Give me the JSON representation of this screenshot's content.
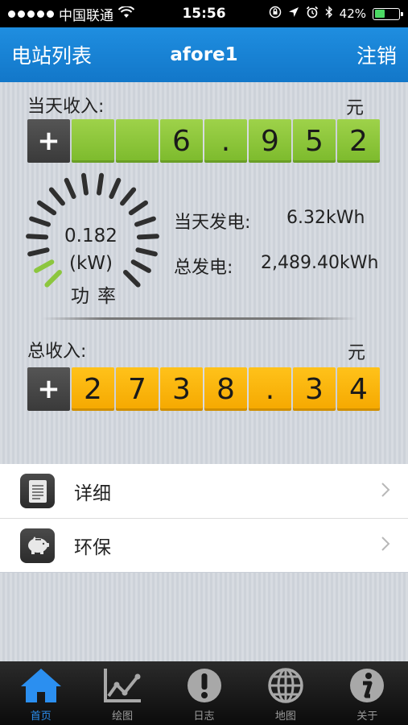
{
  "status_bar": {
    "carrier": "中国联通",
    "time": "15:56",
    "battery": "42%",
    "battery_level": 0.42
  },
  "nav": {
    "left": "电站列表",
    "title": "afore1",
    "right": "注销"
  },
  "today_income": {
    "label": "当天收入:",
    "unit": "元",
    "sign": "+",
    "digits": [
      "",
      "",
      "6",
      ".",
      "9",
      "5",
      "2"
    ]
  },
  "gauge": {
    "value": "0.182",
    "unit": "(kW)",
    "label": "功率",
    "level": 0.1,
    "active_color": "#8cc63f",
    "inactive_color": "#2f2f2f"
  },
  "stats": {
    "today_label": "当天发电:",
    "today_value": "6.32kWh",
    "total_label": "总发电:",
    "total_value": "2,489.40kWh"
  },
  "total_income": {
    "label": "总收入:",
    "unit": "元",
    "sign": "+",
    "digits": [
      "2",
      "7",
      "3",
      "8",
      ".",
      "3",
      "4"
    ]
  },
  "list": [
    {
      "label": "详细",
      "icon": "document-icon"
    },
    {
      "label": "环保",
      "icon": "piggy-bank-icon"
    }
  ],
  "tabs": [
    {
      "label": "首页",
      "icon": "home-icon",
      "active": true
    },
    {
      "label": "绘图",
      "icon": "chart-icon",
      "active": false
    },
    {
      "label": "日志",
      "icon": "alert-icon",
      "active": false
    },
    {
      "label": "地图",
      "icon": "globe-icon",
      "active": false
    },
    {
      "label": "关于",
      "icon": "info-icon",
      "active": false
    }
  ],
  "colors": {
    "nav_blue": "#1a85d8",
    "green_digit": "#8cc63f",
    "orange_digit": "#fbb40f",
    "tab_active": "#2b8ff0"
  }
}
